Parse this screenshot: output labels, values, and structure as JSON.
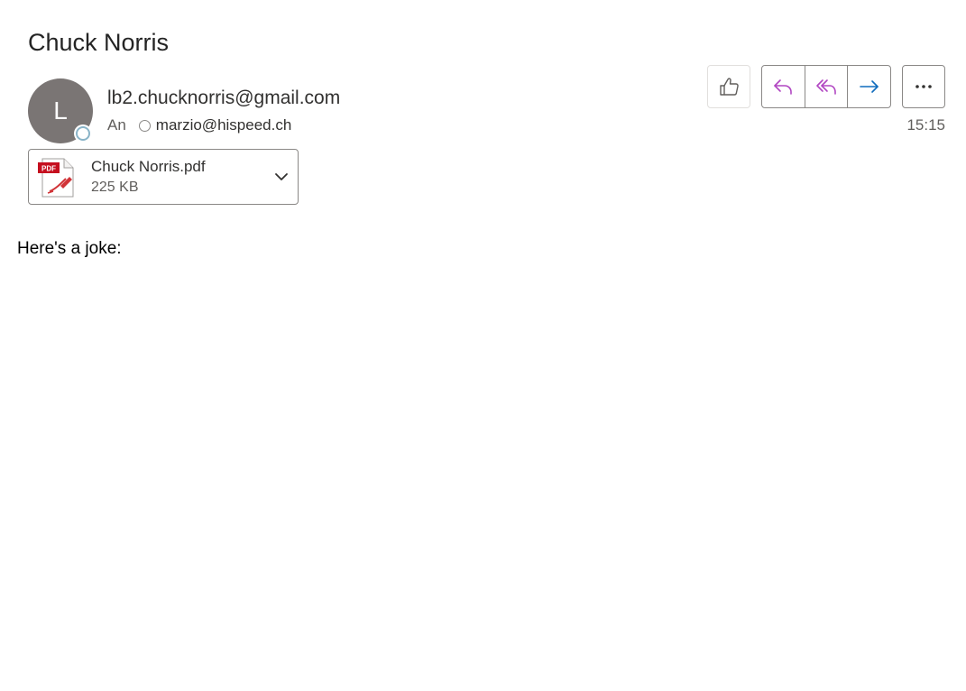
{
  "message": {
    "subject": "Chuck Norris",
    "sender": {
      "initial": "L",
      "email": "lb2.chucknorris@gmail.com"
    },
    "recipients": {
      "label": "An",
      "address": "marzio@hispeed.ch"
    },
    "time": "15:15",
    "attachment": {
      "icon": "pdf-file-icon",
      "name": "Chuck Norris.pdf",
      "size": "225 KB"
    },
    "body": "Here's a joke:"
  },
  "actions": {
    "like_icon": "thumbs-up-icon",
    "reply_icon": "reply-icon",
    "reply_all_icon": "reply-all-icon",
    "forward_icon": "forward-icon",
    "more_icon": "more-icon"
  },
  "colors": {
    "avatar_bg": "#7a7574",
    "reply_accent": "#b146c2",
    "forward_accent": "#0f6cbd",
    "pdf_red": "#d13438"
  }
}
